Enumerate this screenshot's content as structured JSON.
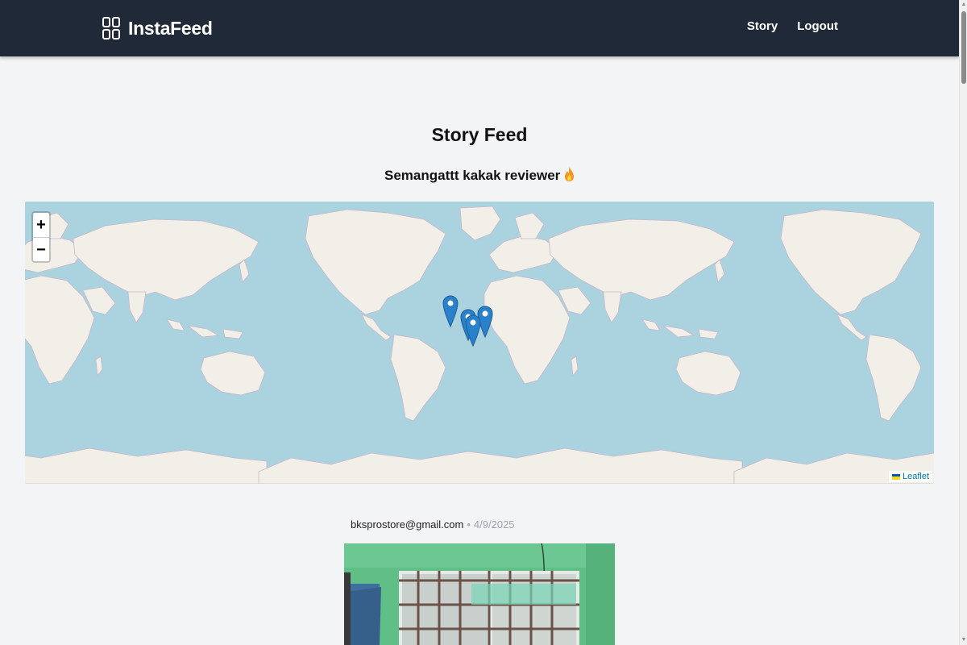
{
  "navbar": {
    "brand": "InstaFeed",
    "brand_icon": "grid-icon",
    "links": [
      {
        "label": "Story"
      },
      {
        "label": "Logout"
      }
    ]
  },
  "page": {
    "title": "Story Feed",
    "subtitle": "Semangattt kakak reviewer",
    "subtitle_emoji": "fire-emoji"
  },
  "map": {
    "zoom_in": "+",
    "zoom_out": "−",
    "attribution": "Leaflet",
    "marker_count": 4,
    "colors": {
      "water": "#aad3df",
      "land": "#f2efe9",
      "marker": "#2a81cb"
    }
  },
  "post": {
    "user": "bksprostore@gmail.com",
    "separator": "•",
    "date": "4/9/2025"
  }
}
